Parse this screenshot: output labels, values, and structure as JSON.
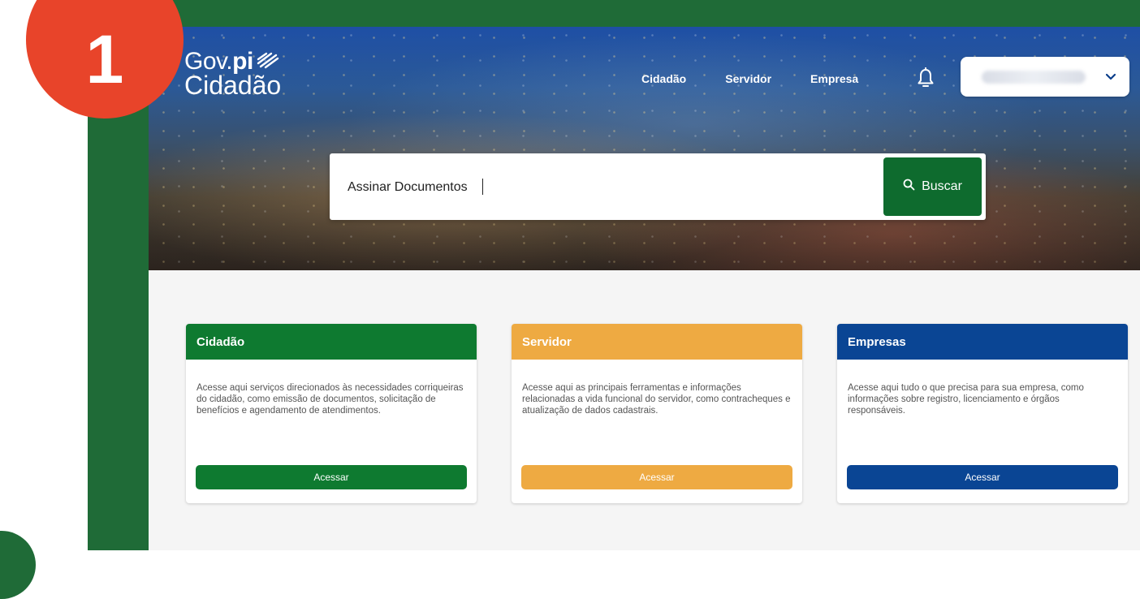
{
  "step_badge": "1",
  "logo": {
    "line1_prefix": "Gov.",
    "line1_bold": "pi",
    "line2": "Cidadão"
  },
  "nav": {
    "items": [
      "Cidadão",
      "Servidor",
      "Empresa"
    ]
  },
  "search": {
    "value": "Assinar Documentos",
    "button_label": "Buscar"
  },
  "cards": [
    {
      "title": "Cidadão",
      "description": "Acesse aqui serviços direcionados às necessidades corriqueiras do cidadão, como emissão de documentos, solicitação de benefícios e agendamento de atendimentos.",
      "button_label": "Acessar",
      "color": "#0e7a30"
    },
    {
      "title": "Servidor",
      "description": "Acesse aqui as principais ferramentas e informações relacionadas a vida funcional do servidor, como contracheques e atualização de dados cadastrais.",
      "button_label": "Acessar",
      "color": "#eeaa42"
    },
    {
      "title": "Empresas",
      "description": "Acesse aqui tudo o que precisa para sua empresa, como informações sobre registro, licenciamento e órgãos responsáveis.",
      "button_label": "Acessar",
      "color": "#0a4594"
    }
  ],
  "icons": {
    "bell": "bell-icon",
    "search": "search-icon",
    "chevron": "chevron-down-icon",
    "logo_mark": "stripes-logo-icon"
  },
  "colors": {
    "frame": "#1f6b37",
    "badge": "#e8442a",
    "primary_green": "#0e6b2e"
  }
}
